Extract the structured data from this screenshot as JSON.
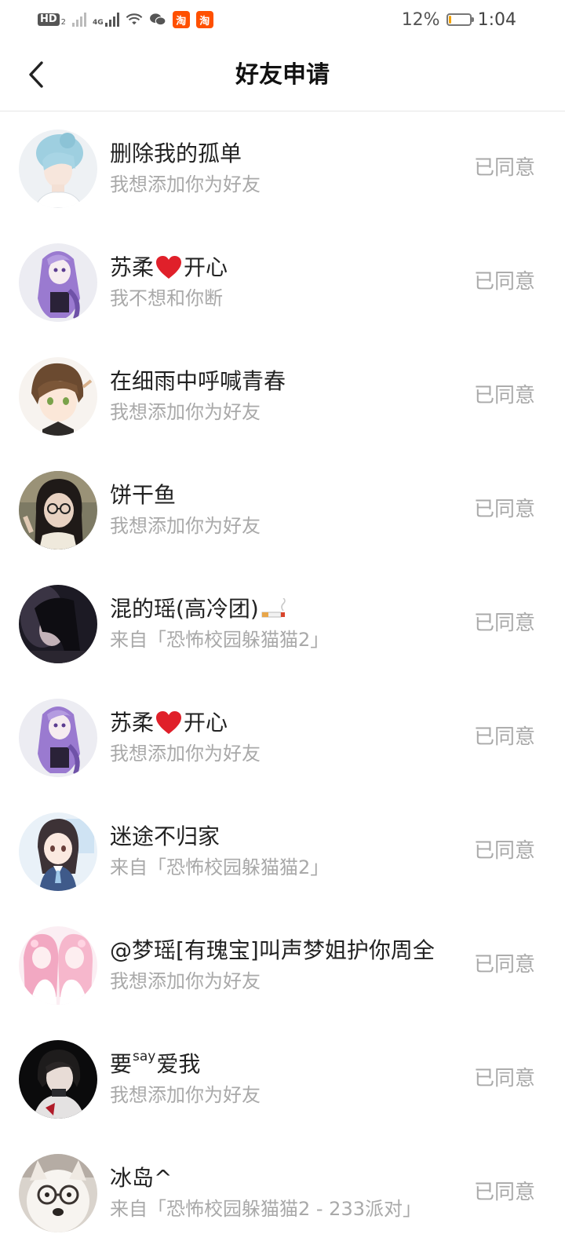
{
  "status_bar": {
    "hd_label": "HD",
    "hd_sub": "2",
    "network_label": "4G",
    "taobao_label_1": "淘",
    "taobao_label_2": "淘",
    "battery_text": "12%",
    "battery_level": 0.12,
    "battery_color": "#f5a300",
    "time": "1:04",
    "icons": [
      "hd-icon",
      "signal-icon",
      "signal-icon",
      "wifi-icon",
      "wechat-icon",
      "taobao-icon",
      "taobao-icon",
      "battery-icon"
    ]
  },
  "header": {
    "title": "好友申请",
    "back_icon": "chevron-left-icon"
  },
  "colors": {
    "secondary_text": "#a9a9a9",
    "primary_text": "#222222",
    "heart": "#e0202a"
  },
  "requests": [
    {
      "name_parts": [
        "删除我的孤单"
      ],
      "message": "我想添加你为好友",
      "status": "已同意",
      "avatar": "avatar-blue-hair-boy"
    },
    {
      "name_parts": [
        "苏柔",
        "开心"
      ],
      "name_icon": "heart-icon",
      "message": "我不想和你断",
      "status": "已同意",
      "avatar": "avatar-purple-hair-anime"
    },
    {
      "name_parts": [
        "在细雨中呼喊青春"
      ],
      "message": "我想添加你为好友",
      "status": "已同意",
      "avatar": "avatar-brown-hair-anime-boy"
    },
    {
      "name_parts": [
        "饼干鱼"
      ],
      "message": "我想添加你为好友",
      "status": "已同意",
      "avatar": "avatar-girl-glasses-photo"
    },
    {
      "name_parts": [
        "混的瑶(高冷团)"
      ],
      "name_icon": "cigarette-icon",
      "message": "来自「恐怖校园躲猫猫2」",
      "status": "已同意",
      "avatar": "avatar-dark-photo"
    },
    {
      "name_parts": [
        "苏柔",
        "开心"
      ],
      "name_icon": "heart-icon",
      "message": "我想添加你为好友",
      "status": "已同意",
      "avatar": "avatar-purple-hair-anime"
    },
    {
      "name_parts": [
        "迷途不归家"
      ],
      "message": "来自「恐怖校园躲猫猫2」",
      "status": "已同意",
      "avatar": "avatar-school-girl-anime"
    },
    {
      "name_parts": [
        "@梦瑶[有瑰宝]叫声梦姐护你周全"
      ],
      "message": "我想添加你为好友",
      "status": "已同意",
      "avatar": "avatar-pink-twins-anime"
    },
    {
      "name_parts": [
        "要",
        "say",
        "爱我"
      ],
      "name_sup_index": 1,
      "message": "我想添加你为好友",
      "status": "已同意",
      "avatar": "avatar-dark-selfie"
    },
    {
      "name_parts": [
        "冰岛^"
      ],
      "message": "来自「恐怖校园躲猫猫2 - 233派对」",
      "status": "已同意",
      "avatar": "avatar-white-dog-glasses"
    }
  ]
}
